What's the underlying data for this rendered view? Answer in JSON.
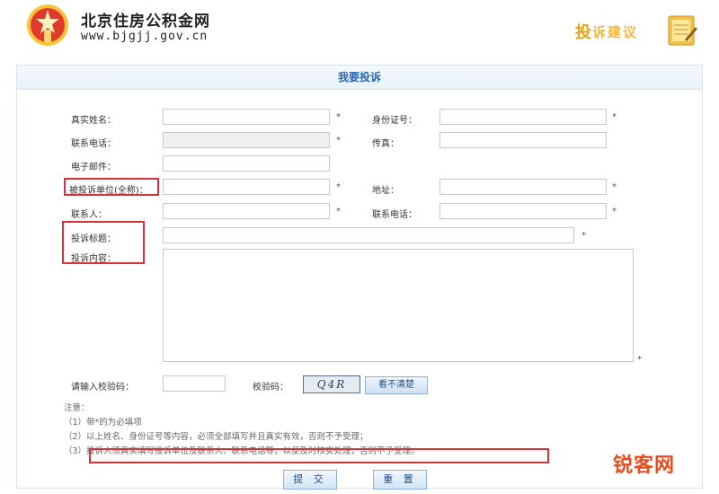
{
  "header": {
    "site_name": "北京住房公积金网",
    "site_url": "www.bjgjj.gov.cn",
    "complain_big": "投",
    "complain_rest": "诉建议"
  },
  "form": {
    "title": "我要投诉",
    "labels": {
      "name": "真实姓名：",
      "id_no": "身份证号：",
      "phone": "联系电话：",
      "fax": "传真：",
      "email": "电子邮件：",
      "unit": "被投诉单位(全称)：",
      "address": "地址：",
      "contact": "联系人：",
      "contact_phone": "联系电话：",
      "subject": "投诉标题：",
      "content": "投诉内容：",
      "captcha_input": "请输入校验码：",
      "captcha": "校验码："
    },
    "required_mark": "*",
    "captcha_text": "Q4R",
    "refresh_label": "看不清楚",
    "notes": {
      "heading": "注意：",
      "items": [
        "（1）带*的为必填项",
        "（2）以上姓名、身份证号等内容，必须全部填写并且真实有效，否则不予受理；",
        "（3）投诉人须真实填写投诉单位及联系人、联系电话等，以便及时核实处理，否则不予受理。"
      ]
    },
    "submit_label": "提 交",
    "reset_label": "重 置"
  },
  "watermark": "锐客网",
  "colors": {
    "title_blue": "#2a66b3",
    "highlight_red": "#d9303a",
    "accent_orange": "#e8a317"
  }
}
